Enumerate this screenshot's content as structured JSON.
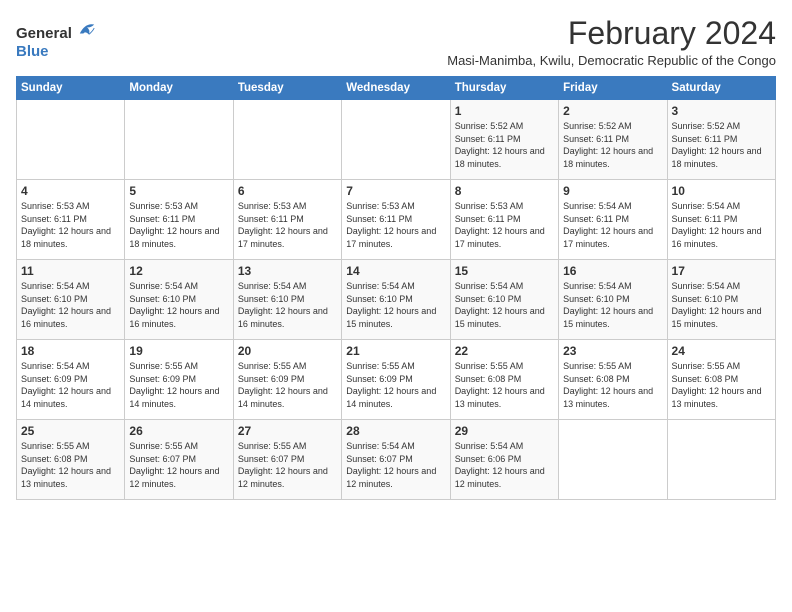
{
  "logo": {
    "general": "General",
    "blue": "Blue"
  },
  "title": "February 2024",
  "subtitle": "Masi-Manimba, Kwilu, Democratic Republic of the Congo",
  "days_of_week": [
    "Sunday",
    "Monday",
    "Tuesday",
    "Wednesday",
    "Thursday",
    "Friday",
    "Saturday"
  ],
  "weeks": [
    [
      {
        "day": "",
        "info": ""
      },
      {
        "day": "",
        "info": ""
      },
      {
        "day": "",
        "info": ""
      },
      {
        "day": "",
        "info": ""
      },
      {
        "day": "1",
        "info": "Sunrise: 5:52 AM\nSunset: 6:11 PM\nDaylight: 12 hours and 18 minutes."
      },
      {
        "day": "2",
        "info": "Sunrise: 5:52 AM\nSunset: 6:11 PM\nDaylight: 12 hours and 18 minutes."
      },
      {
        "day": "3",
        "info": "Sunrise: 5:52 AM\nSunset: 6:11 PM\nDaylight: 12 hours and 18 minutes."
      }
    ],
    [
      {
        "day": "4",
        "info": "Sunrise: 5:53 AM\nSunset: 6:11 PM\nDaylight: 12 hours and 18 minutes."
      },
      {
        "day": "5",
        "info": "Sunrise: 5:53 AM\nSunset: 6:11 PM\nDaylight: 12 hours and 18 minutes."
      },
      {
        "day": "6",
        "info": "Sunrise: 5:53 AM\nSunset: 6:11 PM\nDaylight: 12 hours and 17 minutes."
      },
      {
        "day": "7",
        "info": "Sunrise: 5:53 AM\nSunset: 6:11 PM\nDaylight: 12 hours and 17 minutes."
      },
      {
        "day": "8",
        "info": "Sunrise: 5:53 AM\nSunset: 6:11 PM\nDaylight: 12 hours and 17 minutes."
      },
      {
        "day": "9",
        "info": "Sunrise: 5:54 AM\nSunset: 6:11 PM\nDaylight: 12 hours and 17 minutes."
      },
      {
        "day": "10",
        "info": "Sunrise: 5:54 AM\nSunset: 6:11 PM\nDaylight: 12 hours and 16 minutes."
      }
    ],
    [
      {
        "day": "11",
        "info": "Sunrise: 5:54 AM\nSunset: 6:10 PM\nDaylight: 12 hours and 16 minutes."
      },
      {
        "day": "12",
        "info": "Sunrise: 5:54 AM\nSunset: 6:10 PM\nDaylight: 12 hours and 16 minutes."
      },
      {
        "day": "13",
        "info": "Sunrise: 5:54 AM\nSunset: 6:10 PM\nDaylight: 12 hours and 16 minutes."
      },
      {
        "day": "14",
        "info": "Sunrise: 5:54 AM\nSunset: 6:10 PM\nDaylight: 12 hours and 15 minutes."
      },
      {
        "day": "15",
        "info": "Sunrise: 5:54 AM\nSunset: 6:10 PM\nDaylight: 12 hours and 15 minutes."
      },
      {
        "day": "16",
        "info": "Sunrise: 5:54 AM\nSunset: 6:10 PM\nDaylight: 12 hours and 15 minutes."
      },
      {
        "day": "17",
        "info": "Sunrise: 5:54 AM\nSunset: 6:10 PM\nDaylight: 12 hours and 15 minutes."
      }
    ],
    [
      {
        "day": "18",
        "info": "Sunrise: 5:54 AM\nSunset: 6:09 PM\nDaylight: 12 hours and 14 minutes."
      },
      {
        "day": "19",
        "info": "Sunrise: 5:55 AM\nSunset: 6:09 PM\nDaylight: 12 hours and 14 minutes."
      },
      {
        "day": "20",
        "info": "Sunrise: 5:55 AM\nSunset: 6:09 PM\nDaylight: 12 hours and 14 minutes."
      },
      {
        "day": "21",
        "info": "Sunrise: 5:55 AM\nSunset: 6:09 PM\nDaylight: 12 hours and 14 minutes."
      },
      {
        "day": "22",
        "info": "Sunrise: 5:55 AM\nSunset: 6:08 PM\nDaylight: 12 hours and 13 minutes."
      },
      {
        "day": "23",
        "info": "Sunrise: 5:55 AM\nSunset: 6:08 PM\nDaylight: 12 hours and 13 minutes."
      },
      {
        "day": "24",
        "info": "Sunrise: 5:55 AM\nSunset: 6:08 PM\nDaylight: 12 hours and 13 minutes."
      }
    ],
    [
      {
        "day": "25",
        "info": "Sunrise: 5:55 AM\nSunset: 6:08 PM\nDaylight: 12 hours and 13 minutes."
      },
      {
        "day": "26",
        "info": "Sunrise: 5:55 AM\nSunset: 6:07 PM\nDaylight: 12 hours and 12 minutes."
      },
      {
        "day": "27",
        "info": "Sunrise: 5:55 AM\nSunset: 6:07 PM\nDaylight: 12 hours and 12 minutes."
      },
      {
        "day": "28",
        "info": "Sunrise: 5:54 AM\nSunset: 6:07 PM\nDaylight: 12 hours and 12 minutes."
      },
      {
        "day": "29",
        "info": "Sunrise: 5:54 AM\nSunset: 6:06 PM\nDaylight: 12 hours and 12 minutes."
      },
      {
        "day": "",
        "info": ""
      },
      {
        "day": "",
        "info": ""
      }
    ]
  ]
}
